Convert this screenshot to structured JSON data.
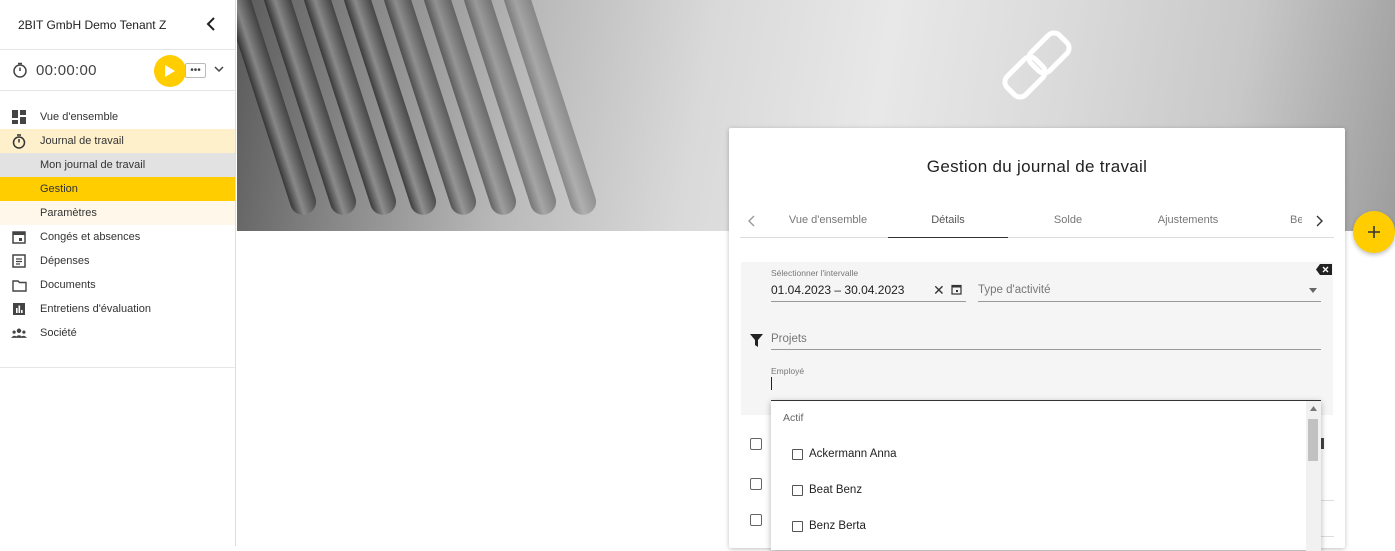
{
  "sidebar": {
    "tenant": "2BIT GmbH Demo Tenant Z",
    "timer": "00:00:00",
    "items": [
      {
        "label": "Vue d'ensemble",
        "icon": "dashboard-icon"
      },
      {
        "label": "Journal de travail",
        "icon": "stopwatch-icon"
      },
      {
        "label": "Congés et absences",
        "icon": "calendar-icon"
      },
      {
        "label": "Dépenses",
        "icon": "receipt-icon"
      },
      {
        "label": "Documents",
        "icon": "folder-icon"
      },
      {
        "label": "Entretiens d'évaluation",
        "icon": "bar-chart-icon"
      },
      {
        "label": "Société",
        "icon": "people-icon"
      }
    ],
    "subitems": [
      "Mon journal de travail",
      "Gestion",
      "Paramètres"
    ]
  },
  "card": {
    "title": "Gestion du journal de travail",
    "tabs": [
      "Vue d'ensemble",
      "Détails",
      "Solde",
      "Ajustements",
      "Be"
    ],
    "active_tab": "Détails"
  },
  "filters": {
    "interval_label": "Sélectionner l'intervalle",
    "interval_value": "01.04.2023 – 30.04.2023",
    "activity_placeholder": "Type d'activité",
    "projects_placeholder": "Projets",
    "employee_label": "Employé"
  },
  "dropdown": {
    "group": "Actif",
    "options": [
      "Ackermann Anna",
      "Beat Benz",
      "Benz Berta"
    ]
  },
  "colors": {
    "accent": "#ffcd00",
    "accent_light": "#fff0cc"
  }
}
